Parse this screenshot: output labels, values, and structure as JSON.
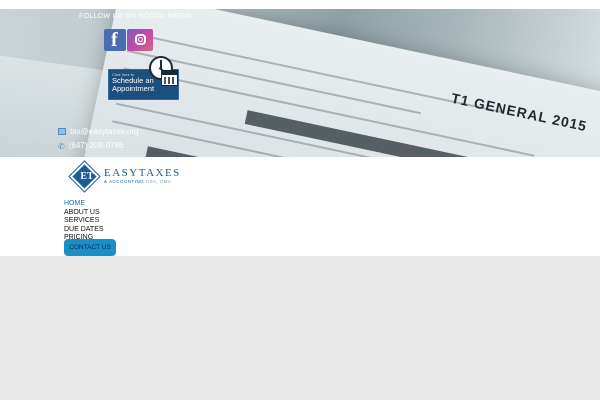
{
  "social": {
    "heading": "FOLLOW US ON SOCIAL MEDIA",
    "icons": [
      "facebook-icon",
      "instagram-icon"
    ]
  },
  "appointment": {
    "small_text": "Click here to",
    "line1": "Schedule an",
    "line2": "Appointment"
  },
  "contact": {
    "email": "tax@easytaxes.org",
    "phone": "(647) 208-0786"
  },
  "hero": {
    "form_text": "T1 GENERAL 2015"
  },
  "logo": {
    "initials": "ET",
    "name": "EASYTAXES",
    "sub": "& ACCOUNTING",
    "sub2": "CPA, CMA"
  },
  "nav": {
    "items": [
      "HOME",
      "ABOUT US",
      "SERVICES",
      "DUE DATES",
      "PRICING"
    ],
    "cta": "CONTACT US"
  },
  "colors": {
    "brand_blue": "#1d5a9a",
    "cta_blue": "#1a8fc7",
    "background": "#e8e8e8"
  }
}
